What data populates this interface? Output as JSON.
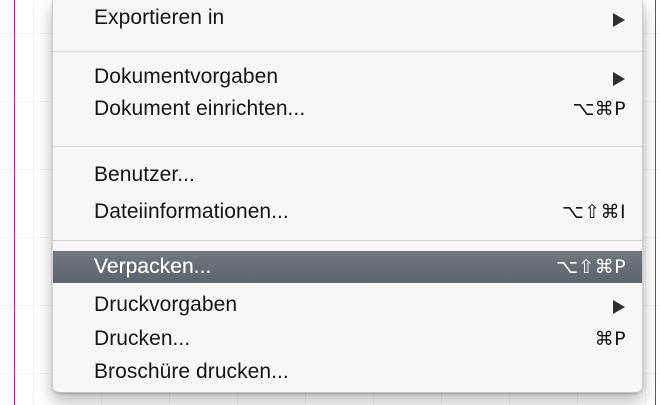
{
  "menu": {
    "items": [
      {
        "label": "Exportieren in",
        "shortcut": "",
        "submenu": true
      },
      {
        "label": "Dokumentvorgaben",
        "shortcut": "",
        "submenu": true
      },
      {
        "label": "Dokument einrichten...",
        "shortcut": "⌥⌘P",
        "submenu": false
      },
      {
        "label": "Benutzer...",
        "shortcut": "",
        "submenu": false
      },
      {
        "label": "Dateiinformationen...",
        "shortcut": "⌥⇧⌘I",
        "submenu": false
      },
      {
        "label": "Verpacken...",
        "shortcut": "⌥⇧⌘P",
        "submenu": false,
        "highlighted": true
      },
      {
        "label": "Druckvorgaben",
        "shortcut": "",
        "submenu": true
      },
      {
        "label": "Drucken...",
        "shortcut": "⌘P",
        "submenu": false
      },
      {
        "label": "Broschüre drucken...",
        "shortcut": "",
        "submenu": false
      }
    ]
  },
  "colors": {
    "guide": "#d21b7a",
    "highlight": "#646b74",
    "menu_bg": "#f7f7f7"
  }
}
